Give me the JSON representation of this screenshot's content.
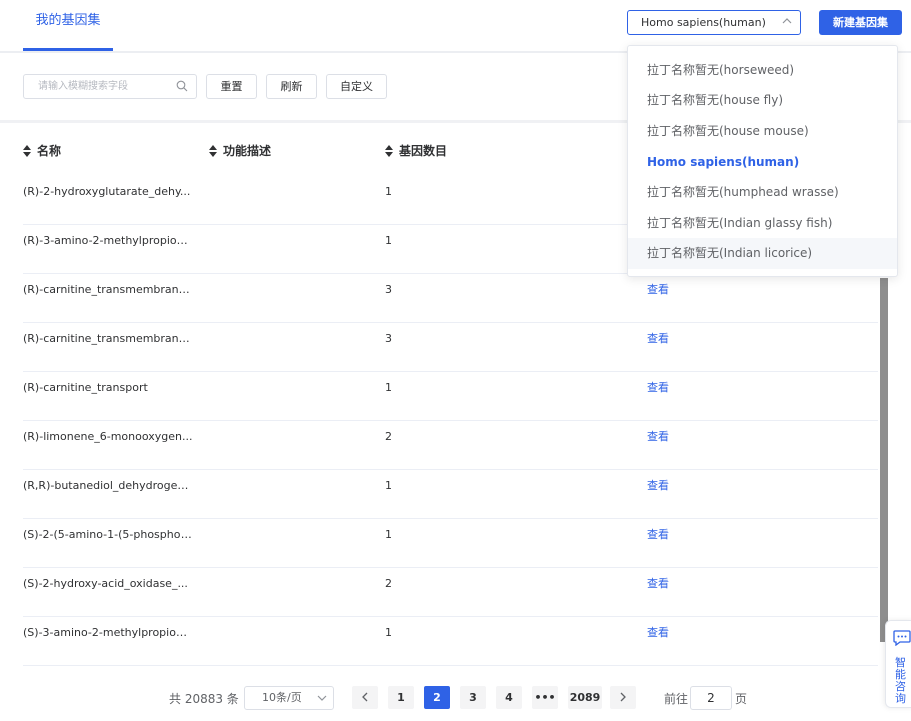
{
  "header": {
    "tab_label": "我的基因集",
    "species_selected": "Homo sapiens(human)",
    "new_button": "新建基因集"
  },
  "toolbar": {
    "search_placeholder": "请输入模糊搜索字段",
    "reset": "重置",
    "refresh": "刷新",
    "customize": "自定义"
  },
  "table": {
    "columns": [
      "名称",
      "功能描述",
      "基因数目"
    ],
    "view_label": "查看",
    "rows": [
      {
        "name": "(R)-2-hydroxyglutarate_dehy...",
        "count": "1",
        "view": ""
      },
      {
        "name": "(R)-3-amino-2-methylpropion...",
        "count": "1",
        "view": ""
      },
      {
        "name": "(R)-carnitine_transmembrane...",
        "count": "3",
        "view": "查看"
      },
      {
        "name": "(R)-carnitine_transmembrane...",
        "count": "3",
        "view": "查看"
      },
      {
        "name": "(R)-carnitine_transport",
        "count": "1",
        "view": "查看"
      },
      {
        "name": "(R)-limonene_6-monooxygen...",
        "count": "2",
        "view": "查看"
      },
      {
        "name": "(R,R)-butanediol_dehydrogen...",
        "count": "1",
        "view": "查看"
      },
      {
        "name": "(S)-2-(5-amino-1-(5-phospho-...",
        "count": "1",
        "view": "查看"
      },
      {
        "name": "(S)-2-hydroxy-acid_oxidase_...",
        "count": "2",
        "view": "查看"
      },
      {
        "name": "(S)-3-amino-2-methylpropion...",
        "count": "1",
        "view": "查看"
      }
    ]
  },
  "dropdown": {
    "options": [
      "拉丁名称暂无(horseweed)",
      "拉丁名称暂无(house fly)",
      "拉丁名称暂无(house mouse)",
      "Homo sapiens(human)",
      "拉丁名称暂无(humphead wrasse)",
      "拉丁名称暂无(Indian glassy fish)",
      "拉丁名称暂无(Indian licorice)"
    ]
  },
  "pagination": {
    "total": "共 20883 条",
    "page_size": "10条/页",
    "pages": [
      "1",
      "2",
      "3",
      "4",
      "•••",
      "2089"
    ],
    "current_page": "2",
    "goto_prefix": "前往",
    "goto_value": "2",
    "goto_suffix": "页"
  },
  "assistant": {
    "label": "智能咨询"
  },
  "colors": {
    "primary": "#2f62e6",
    "scrollbar": "#8e8e8e"
  }
}
